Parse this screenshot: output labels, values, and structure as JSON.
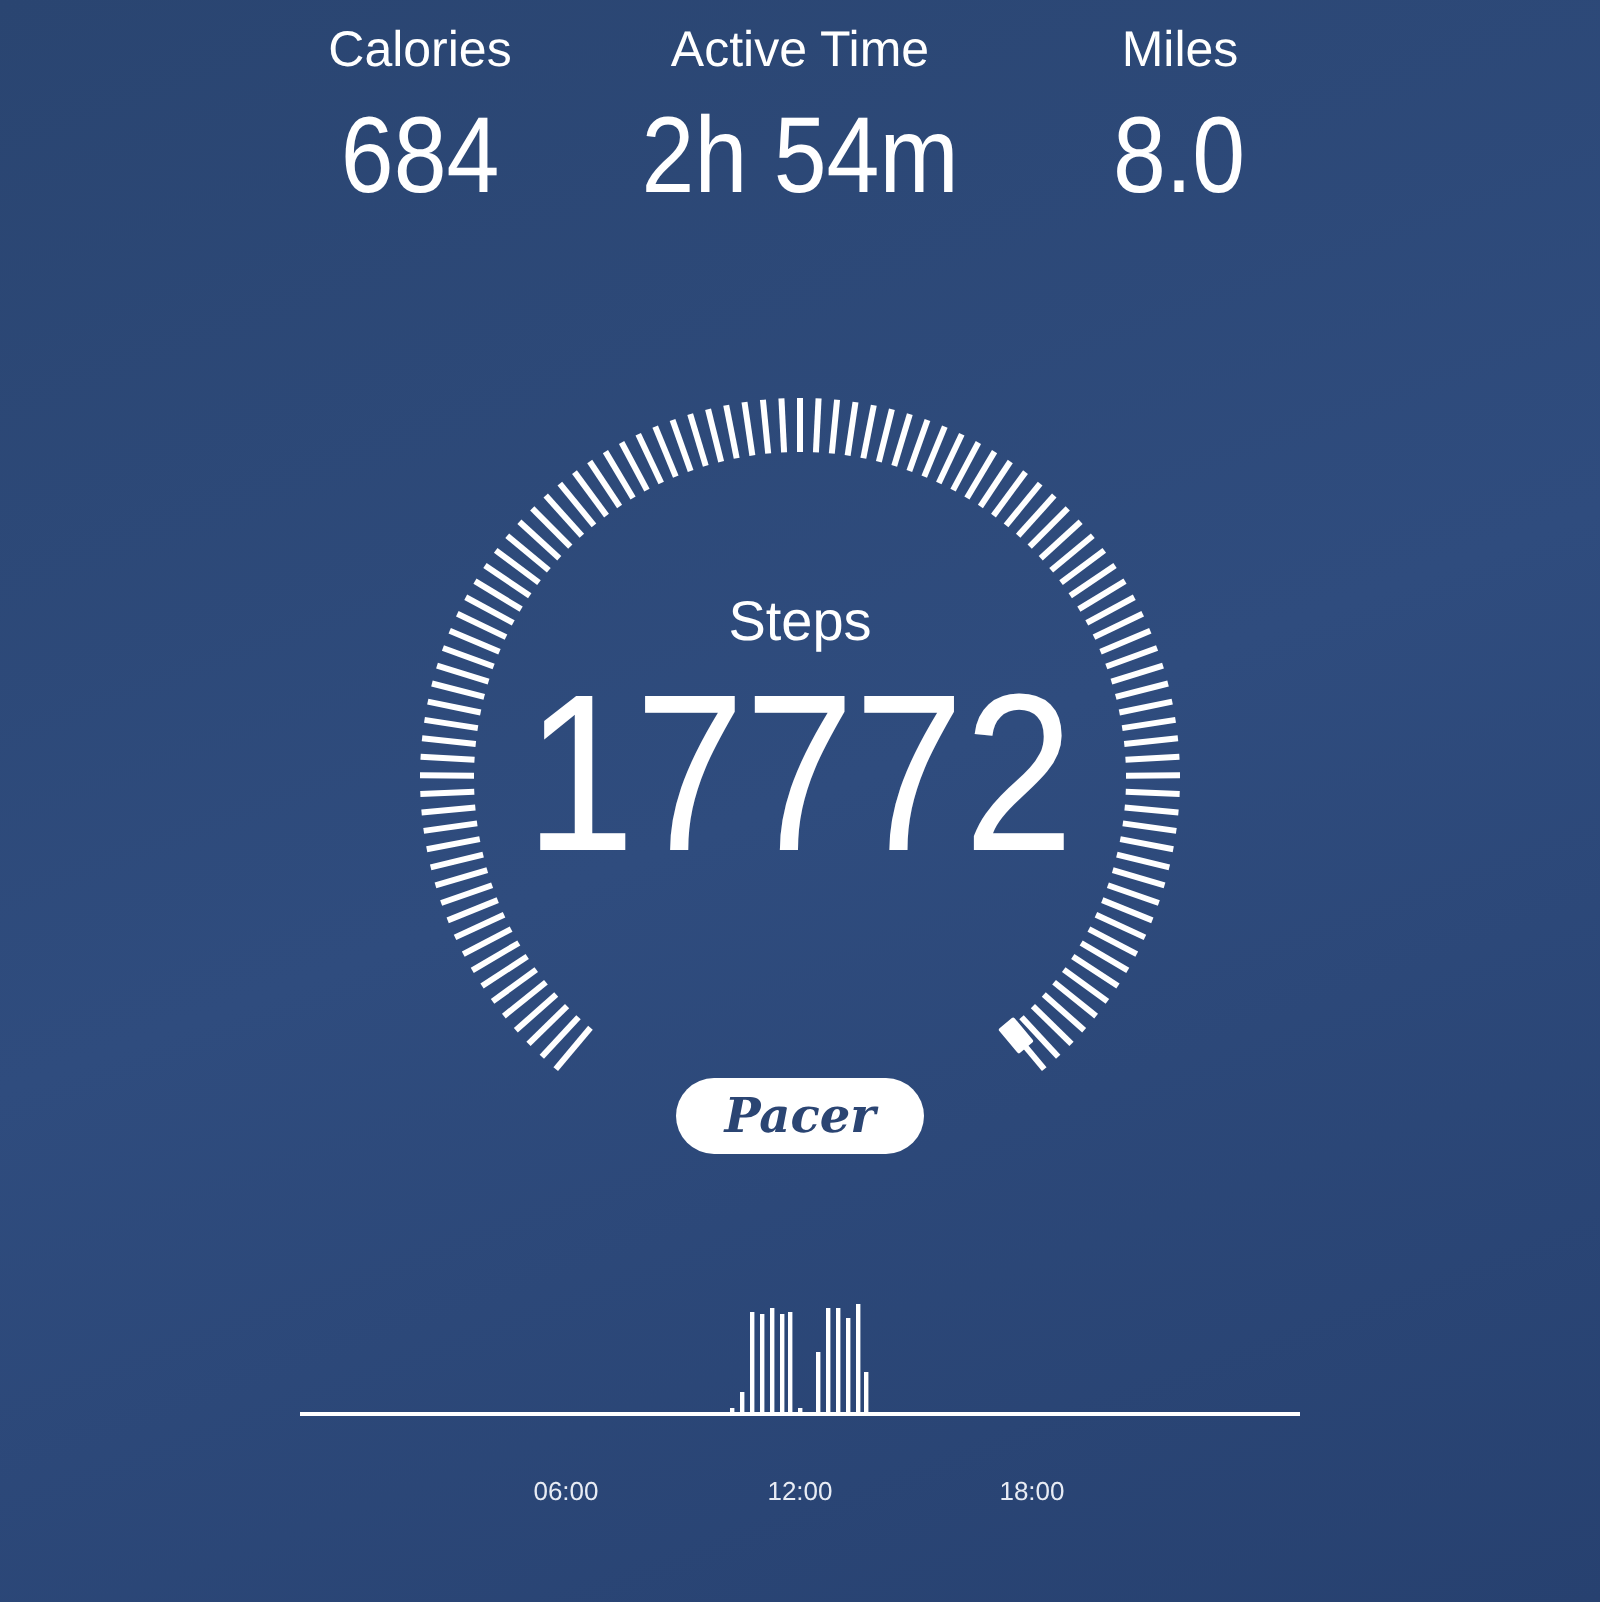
{
  "stats": [
    {
      "label": "Calories",
      "value": "684"
    },
    {
      "label": "Active Time",
      "value": "2h 54m"
    },
    {
      "label": "Miles",
      "value": "8.0"
    }
  ],
  "gauge": {
    "label": "Steps",
    "value": "17772"
  },
  "brand": {
    "name": "Pacer"
  },
  "activity": {
    "time_labels": [
      "06:00",
      "12:00",
      "18:00"
    ]
  }
}
